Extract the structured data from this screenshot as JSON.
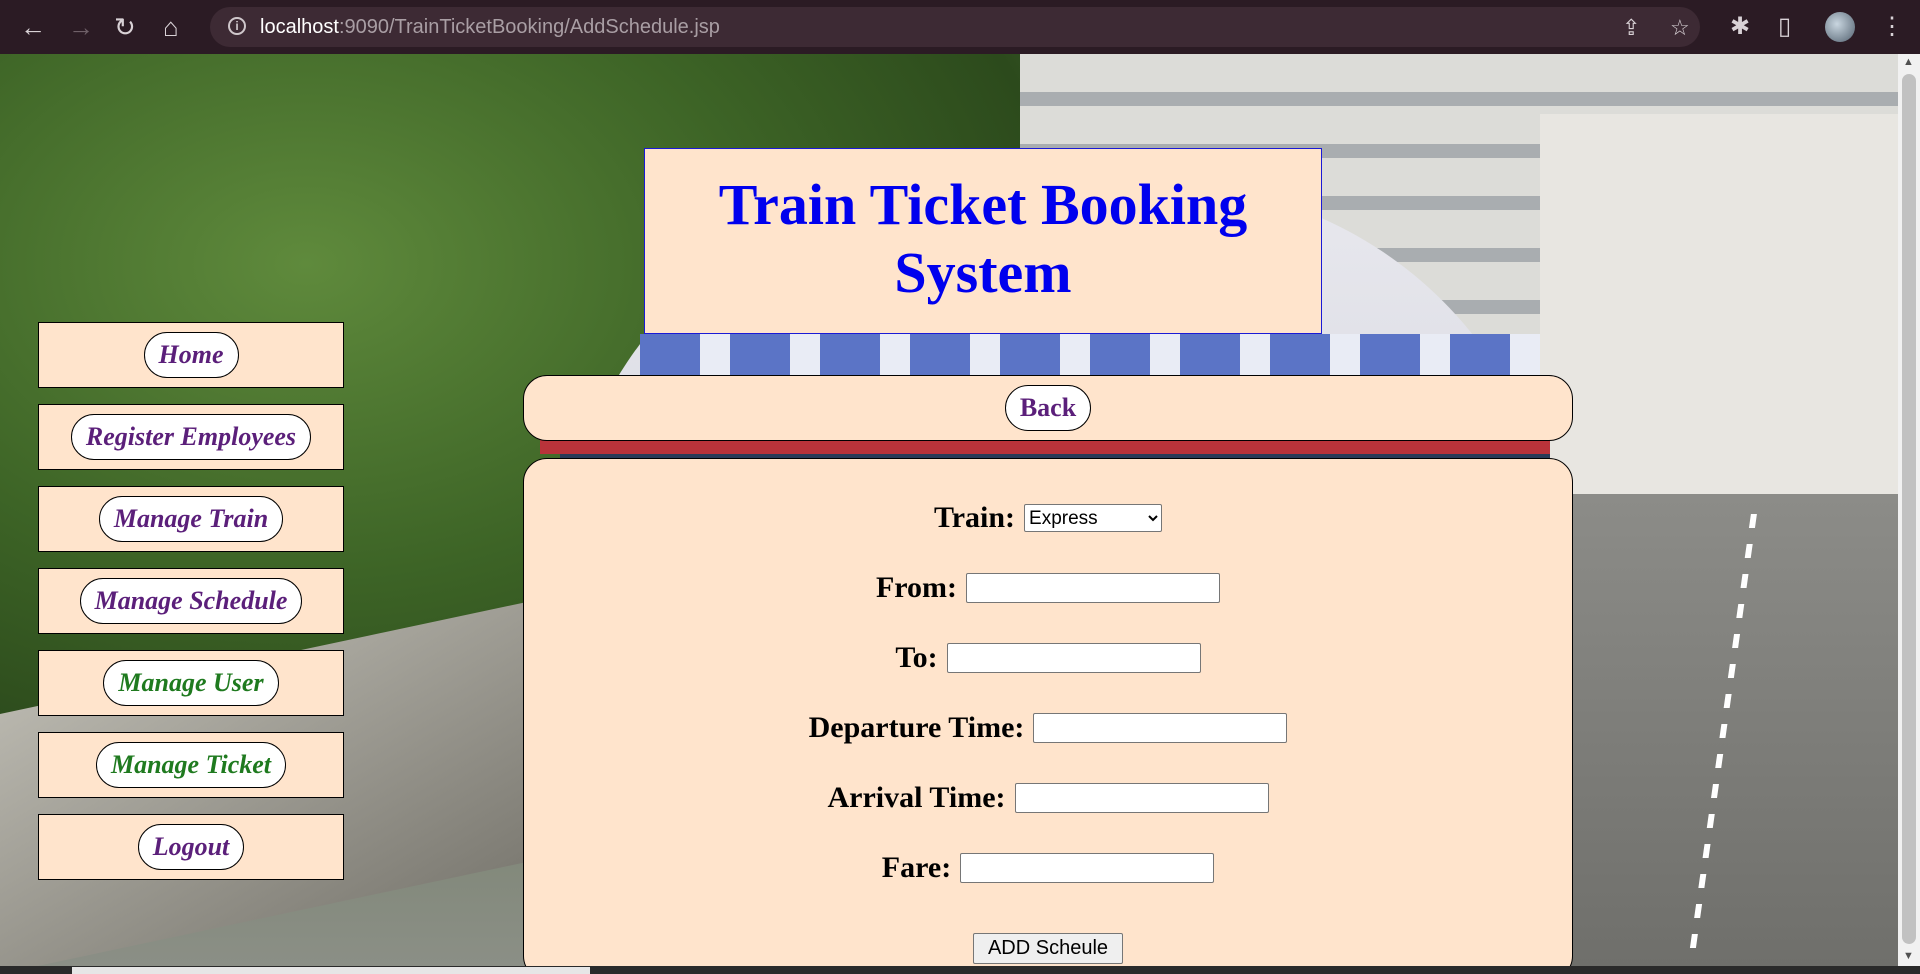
{
  "browser": {
    "url_host": "localhost",
    "url_path": ":9090/TrainTicketBooking/AddSchedule.jsp",
    "back_icon": "←",
    "forward_icon": "→",
    "reload_icon": "↻",
    "home_icon": "⌂",
    "share_icon": "⇪",
    "star_icon": "☆",
    "extensions_icon": "✱",
    "sidepanel_icon": "▯",
    "menu_icon": "⋮",
    "info_icon": "i"
  },
  "header": {
    "title_line1": "Train Ticket Booking",
    "title_line2": "System"
  },
  "sidebar": {
    "items": [
      {
        "label": "Home",
        "color": "#5b1f7a"
      },
      {
        "label": "Register Employees",
        "color": "#5b1f7a"
      },
      {
        "label": "Manage Train",
        "color": "#5b1f7a"
      },
      {
        "label": "Manage Schedule",
        "color": "#5b1f7a"
      },
      {
        "label": "Manage User",
        "color": "#1f7a1f"
      },
      {
        "label": "Manage Ticket",
        "color": "#1f7a1f"
      },
      {
        "label": "Logout",
        "color": "#5b1f7a"
      }
    ]
  },
  "backbar": {
    "back_label": "Back"
  },
  "form": {
    "train_label": "Train:",
    "train_selected": "Express",
    "from_label": "From:",
    "from_value": "",
    "to_label": "To:",
    "to_value": "",
    "departure_label": "Departure Time:",
    "departure_value": "",
    "arrival_label": "Arrival Time:",
    "arrival_value": "",
    "fare_label": "Fare:",
    "fare_value": "",
    "submit_label": "ADD Scheule"
  },
  "colors": {
    "panel_bg": "#ffe4cc",
    "title_color": "#0000ee",
    "chrome_bg": "#2b1b24"
  }
}
